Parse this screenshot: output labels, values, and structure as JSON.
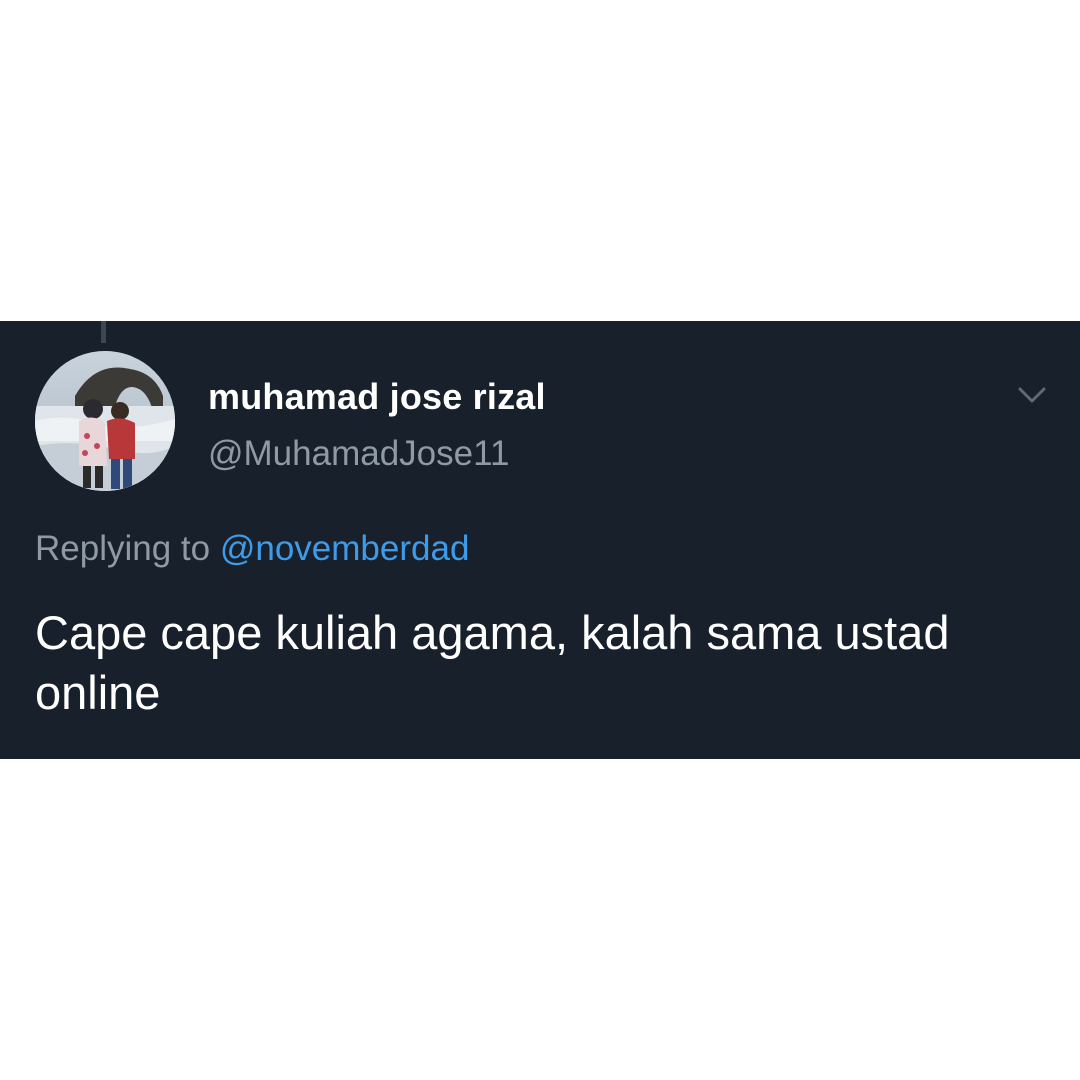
{
  "tweet": {
    "display_name": "muhamad jose rizal",
    "handle": "@MuhamadJose11",
    "reply_prefix": "Replying to",
    "reply_target": "@novemberdad",
    "text": "Cape cape kuliah agama, kalah sama ustad online"
  },
  "icons": {
    "more_menu": "chevron-down-icon",
    "avatar": "profile-photo"
  },
  "colors": {
    "background": "#18202b",
    "page_background": "#ffffff",
    "primary_text": "#ffffff",
    "secondary_text": "#8f9aa5",
    "link": "#3e9be8"
  }
}
